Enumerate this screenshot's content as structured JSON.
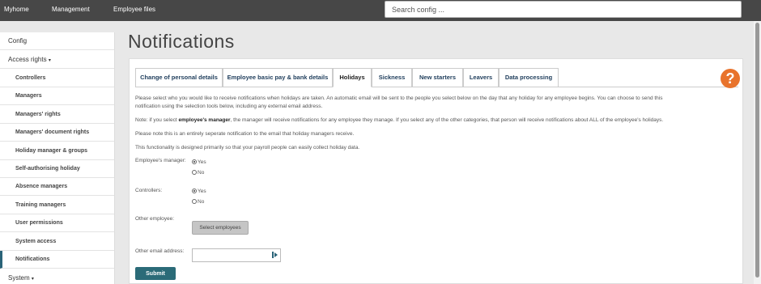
{
  "topnav": [
    "Myhome",
    "Management",
    "Employee files"
  ],
  "search": {
    "placeholder": "Search config ..."
  },
  "sidebar": {
    "config": "Config",
    "access_rights": "Access rights",
    "items": [
      "Controllers",
      "Managers",
      "Managers' rights",
      "Managers' document rights",
      "Holiday manager & groups",
      "Self-authorising holiday",
      "Absence managers",
      "Training managers",
      "User permissions",
      "System access",
      "Notifications"
    ],
    "system": "System",
    "caret": "▾"
  },
  "page": {
    "title": "Notifications"
  },
  "tabs": [
    "Change of personal details",
    "Employee basic pay & bank details",
    "Holidays",
    "Sickness",
    "New starters",
    "Leavers",
    "Data processing"
  ],
  "help": {
    "glyph": "?"
  },
  "content": {
    "p1a": "Please select who you would like to receive notifications when holidays are taken. An automatic email will be sent to the people you select below on the day that any holiday for any employee begins. You can choose to send this",
    "p1b": "notification using the selection tools below, including any external email address.",
    "p2_pre": "Note: if you select ",
    "p2_bold": "employee's manager",
    "p2_post": ", the manager will receive notifications for any employee they manage. If you select any of the other categories, that person will receive notifications about ALL of the employee's holidays.",
    "p3": "Please note this is an entirely seperate notification to the email that holiday managers receive.",
    "p4": "This functionality is designed primarily so that your payroll people can easily collect holiday data."
  },
  "form": {
    "employee_manager_label": "Employee's manager:",
    "controllers_label": "Controllers:",
    "yes": "Yes",
    "no": "No",
    "other_employee_label": "Other employee:",
    "select_employees": "Select employees",
    "other_email_label": "Other email address:",
    "other_email_value": "",
    "submit": "Submit"
  }
}
